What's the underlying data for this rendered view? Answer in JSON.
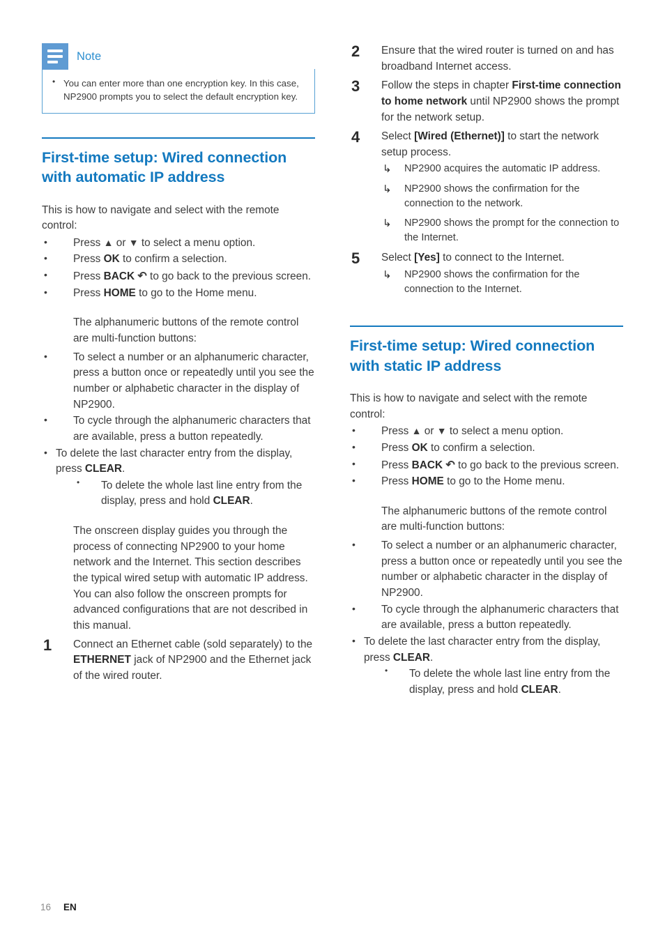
{
  "note": {
    "icon": "note-lines-icon",
    "title": "Note",
    "accent_color": "#5f9bd3",
    "items": [
      "You can enter more than one encryption key. In this case, NP2900 prompts you to select the default encryption key."
    ]
  },
  "heading_color": "#1379bf",
  "left_column": {
    "section": {
      "title": "First-time setup: Wired connection with automatic IP address",
      "lead": "This is how to navigate and select with the remote control:",
      "nav_bullets": [
        {
          "prefix": "Press ",
          "sym1": "▲",
          "mid": " or ",
          "sym2": "▼",
          "suffix": " to select a menu option."
        },
        {
          "prefix": "Press ",
          "bold": "OK",
          "suffix": " to confirm a selection."
        },
        {
          "prefix": "Press ",
          "bold": "BACK",
          "sym1": "↶",
          "suffix": " to go back to the previous screen."
        },
        {
          "prefix": "Press ",
          "bold": "HOME",
          "suffix": " to go to the Home menu."
        }
      ],
      "alnum_intro": "The alphanumeric buttons of the remote control are multi-function buttons:",
      "alnum_bullets": [
        "To select a number or an alphanumeric character, press a button once or repeatedly until you see the number or alphabetic character in the display of NP2900.",
        "To cycle through the alphanumeric characters that are available, press a button repeatedly."
      ],
      "clear_bullet": {
        "prefix": "To delete the last character entry from the display, press ",
        "bold": "CLEAR",
        "suffix": "."
      },
      "clear_sub_bullet": {
        "prefix": "To delete the whole last line entry from the display, press and hold ",
        "bold": "CLEAR",
        "suffix": "."
      },
      "onscreen_para": "The onscreen display guides you through the process of connecting NP2900 to your home network and the Internet. This section describes the typical wired setup with automatic IP address. You can also follow the onscreen prompts for advanced configurations that are not described in this manual.",
      "step1": {
        "num": "1",
        "prefix": "Connect an Ethernet cable (sold separately) to the ",
        "bold": "ETHERNET",
        "suffix": " jack of NP2900 and the Ethernet jack of the wired router."
      }
    }
  },
  "right_column": {
    "steps": [
      {
        "num": "2",
        "text": "Ensure that the wired router is turned on and has broadband Internet access."
      },
      {
        "num": "3",
        "prefix": "Follow the steps in chapter ",
        "bold": "First-time connection to home network",
        "suffix": " until NP2900 shows the prompt for the network setup."
      },
      {
        "num": "4",
        "prefix": "Select ",
        "bold": "[Wired (Ethernet)]",
        "suffix": " to start the network setup process.",
        "results": [
          "NP2900 acquires the automatic IP address.",
          "NP2900 shows the confirmation for the connection to the network.",
          "NP2900 shows the prompt for the connection to the Internet."
        ]
      },
      {
        "num": "5",
        "prefix": "Select ",
        "bold": "[Yes]",
        "suffix": " to connect to the Internet.",
        "results": [
          "NP2900 shows the confirmation for the connection to the Internet."
        ]
      }
    ],
    "section": {
      "title": "First-time setup: Wired connection with static IP address",
      "lead": "This is how to navigate and select with the remote control:",
      "nav_bullets": [
        {
          "prefix": "Press ",
          "sym1": "▲",
          "mid": " or ",
          "sym2": "▼",
          "suffix": " to select a menu option."
        },
        {
          "prefix": "Press ",
          "bold": "OK",
          "suffix": " to confirm a selection."
        },
        {
          "prefix": "Press ",
          "bold": "BACK",
          "sym1": "↶",
          "suffix": " to go back to the previous screen."
        },
        {
          "prefix": "Press ",
          "bold": "HOME",
          "suffix": " to go to the Home menu."
        }
      ],
      "alnum_intro": "The alphanumeric buttons of the remote control are multi-function buttons:",
      "alnum_bullets": [
        "To select a number or an alphanumeric character, press a button once or repeatedly until you see the number or alphabetic character in the display of NP2900.",
        "To cycle through the alphanumeric characters that are available, press a button repeatedly."
      ],
      "clear_bullet": {
        "prefix": "To delete the last character entry from the display, press ",
        "bold": "CLEAR",
        "suffix": "."
      },
      "clear_sub_bullet": {
        "prefix": "To delete the whole last line entry from the display, press and hold ",
        "bold": "CLEAR",
        "suffix": "."
      }
    }
  },
  "footer": {
    "page_number": "16",
    "language": "EN"
  },
  "glyphs": {
    "result_arrow": "↳",
    "back_arrow": "↶",
    "up_triangle": "▲",
    "down_triangle": "▼",
    "bullet": "•"
  }
}
